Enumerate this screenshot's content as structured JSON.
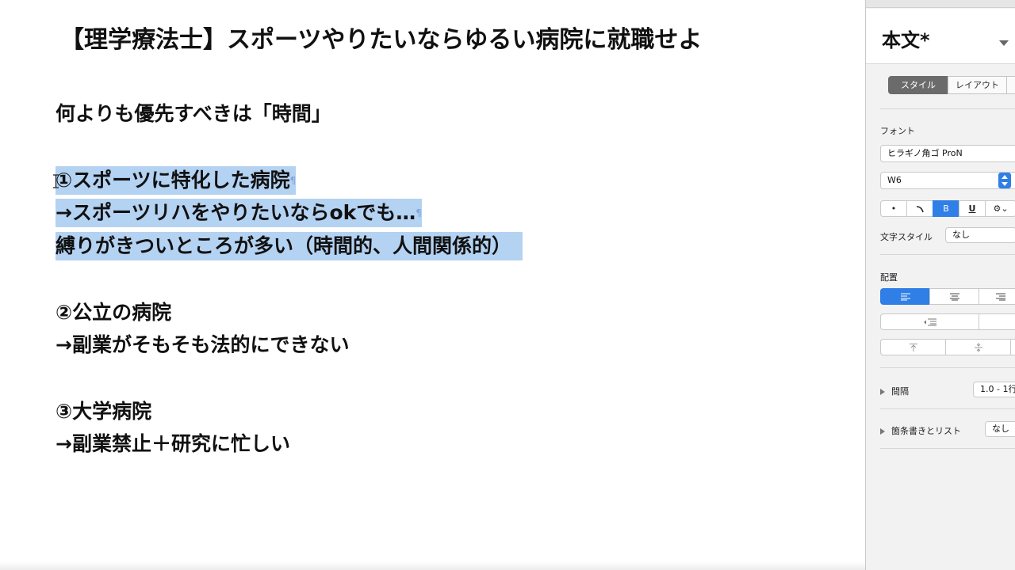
{
  "document": {
    "title": "【理学療法士】スポーツやりたいならゆるい病院に就職せよ",
    "intro": "何よりも優先すべきは「時間」",
    "items": [
      {
        "heading": "①スポーツに特化した病院",
        "lines": [
          "→スポーツリハをやりたいならokでも…",
          "縛りがきついところが多い（時間的、人間関係的）"
        ]
      },
      {
        "heading": "②公立の病院",
        "lines": [
          "→副業がそもそも法的にできない"
        ]
      },
      {
        "heading": "③大学病院",
        "lines": [
          "→副業禁止＋研究に忙しい"
        ]
      }
    ],
    "pilcrow": "¶"
  },
  "sidebar": {
    "paragraph_style": "本文*",
    "tabs": [
      "スタイル",
      "レイアウト"
    ],
    "font_section": "フォント",
    "font_family": "ヒラギノ角ゴ ProN",
    "font_weight": "W6",
    "format_buttons": {
      "bold": "B",
      "underline": "U",
      "bullet": "•"
    },
    "char_style_label": "文字スタイル",
    "char_style_value": "なし",
    "alignment_section": "配置",
    "spacing_label": "間隔",
    "spacing_value": "1.0 - 1行",
    "bullets_label": "箇条書きとリスト",
    "bullets_value": "なし"
  },
  "colors": {
    "selection": "#b4d2f2",
    "accent": "#2f7fe6"
  }
}
